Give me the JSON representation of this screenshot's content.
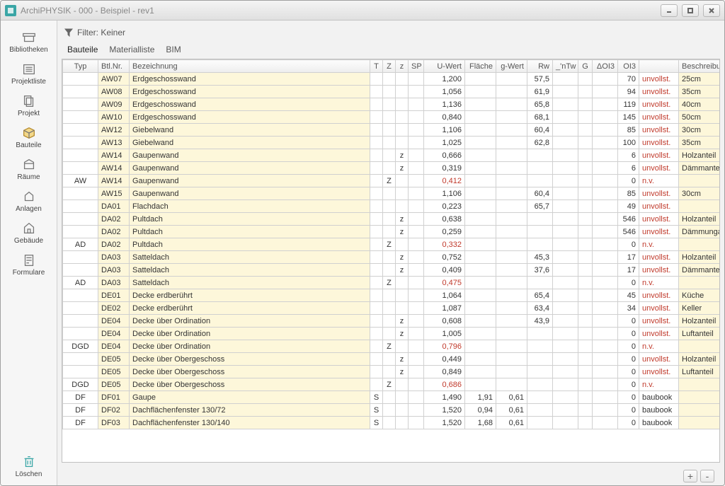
{
  "window": {
    "title": "ArchiPHYSIK - 000 - Beispiel - rev1"
  },
  "sidebar": {
    "items": [
      {
        "label": "Bibliotheken"
      },
      {
        "label": "Projektliste"
      },
      {
        "label": "Projekt"
      },
      {
        "label": "Bauteile"
      },
      {
        "label": "Räume"
      },
      {
        "label": "Anlagen"
      },
      {
        "label": "Gebäude"
      },
      {
        "label": "Formulare"
      }
    ],
    "delete_label": "Löschen"
  },
  "filter": {
    "label": "Filter: Keiner"
  },
  "tabs": [
    {
      "label": "Bauteile",
      "sel": true
    },
    {
      "label": "Materialliste",
      "sel": false
    },
    {
      "label": "BIM",
      "sel": false
    }
  ],
  "columns": [
    {
      "key": "typ",
      "label": "Typ"
    },
    {
      "key": "nr",
      "label": "Btl.Nr."
    },
    {
      "key": "bez",
      "label": "Bezeichnung"
    },
    {
      "key": "T",
      "label": "T"
    },
    {
      "key": "Z",
      "label": "Z"
    },
    {
      "key": "z",
      "label": "z"
    },
    {
      "key": "SP",
      "label": "SP"
    },
    {
      "key": "uw",
      "label": "U-Wert"
    },
    {
      "key": "fl",
      "label": "Fläche"
    },
    {
      "key": "gw",
      "label": "g-Wert"
    },
    {
      "key": "rw",
      "label": "Rw"
    },
    {
      "key": "ntw",
      "label": "_'nTw"
    },
    {
      "key": "G",
      "label": "G"
    },
    {
      "key": "doi",
      "label": "ΔOI3"
    },
    {
      "key": "oi3",
      "label": "OI3"
    },
    {
      "key": "besch",
      "label": "Beschreibung"
    }
  ],
  "rows": [
    {
      "typ": "",
      "nr": "AW07",
      "bez": "Erdgeschosswand",
      "T": "",
      "Z": "",
      "z": "",
      "SP": "",
      "uw": "1,200",
      "fl": "",
      "gw": "",
      "rw": "57,5",
      "ntw": "",
      "G": "",
      "doi": "",
      "oi3": "70",
      "oi3s": "unvollst.",
      "besch": "25cm",
      "yel": true
    },
    {
      "typ": "",
      "nr": "AW08",
      "bez": "Erdgeschosswand",
      "T": "",
      "Z": "",
      "z": "",
      "SP": "",
      "uw": "1,056",
      "fl": "",
      "gw": "",
      "rw": "61,9",
      "ntw": "",
      "G": "",
      "doi": "",
      "oi3": "94",
      "oi3s": "unvollst.",
      "besch": "35cm",
      "yel": true
    },
    {
      "typ": "",
      "nr": "AW09",
      "bez": "Erdgeschosswand",
      "T": "",
      "Z": "",
      "z": "",
      "SP": "",
      "uw": "1,136",
      "fl": "",
      "gw": "",
      "rw": "65,8",
      "ntw": "",
      "G": "",
      "doi": "",
      "oi3": "119",
      "oi3s": "unvollst.",
      "besch": "40cm",
      "yel": true
    },
    {
      "typ": "",
      "nr": "AW10",
      "bez": "Erdgeschosswand",
      "T": "",
      "Z": "",
      "z": "",
      "SP": "",
      "uw": "0,840",
      "fl": "",
      "gw": "",
      "rw": "68,1",
      "ntw": "",
      "G": "",
      "doi": "",
      "oi3": "145",
      "oi3s": "unvollst.",
      "besch": "50cm",
      "yel": true
    },
    {
      "typ": "",
      "nr": "AW12",
      "bez": "Giebelwand",
      "T": "",
      "Z": "",
      "z": "",
      "SP": "",
      "uw": "1,106",
      "fl": "",
      "gw": "",
      "rw": "60,4",
      "ntw": "",
      "G": "",
      "doi": "",
      "oi3": "85",
      "oi3s": "unvollst.",
      "besch": "30cm",
      "yel": true
    },
    {
      "typ": "",
      "nr": "AW13",
      "bez": "Giebelwand",
      "T": "",
      "Z": "",
      "z": "",
      "SP": "",
      "uw": "1,025",
      "fl": "",
      "gw": "",
      "rw": "62,8",
      "ntw": "",
      "G": "",
      "doi": "",
      "oi3": "100",
      "oi3s": "unvollst.",
      "besch": "35cm",
      "yel": true
    },
    {
      "typ": "",
      "nr": "AW14",
      "bez": "Gaupenwand",
      "T": "",
      "Z": "",
      "z": "z",
      "SP": "",
      "uw": "0,666",
      "fl": "",
      "gw": "",
      "rw": "",
      "ntw": "",
      "G": "",
      "doi": "",
      "oi3": "6",
      "oi3s": "unvollst.",
      "besch": "Holzanteil",
      "yel": true
    },
    {
      "typ": "",
      "nr": "AW14",
      "bez": "Gaupenwand",
      "T": "",
      "Z": "",
      "z": "z",
      "SP": "",
      "uw": "0,319",
      "fl": "",
      "gw": "",
      "rw": "",
      "ntw": "",
      "G": "",
      "doi": "",
      "oi3": "6",
      "oi3s": "unvollst.",
      "besch": "Dämmanteil",
      "yel": true
    },
    {
      "typ": "AW",
      "nr": "AW14",
      "bez": "Gaupenwand",
      "T": "",
      "Z": "Z",
      "z": "",
      "SP": "",
      "uw": "0,412",
      "uwRed": true,
      "fl": "",
      "gw": "",
      "rw": "",
      "ntw": "",
      "G": "",
      "doi": "",
      "oi3": "0",
      "oi3s": "n.v.",
      "besch": "",
      "yel": true
    },
    {
      "typ": "",
      "nr": "AW15",
      "bez": "Gaupenwand",
      "T": "",
      "Z": "",
      "z": "",
      "SP": "",
      "uw": "1,106",
      "fl": "",
      "gw": "",
      "rw": "60,4",
      "ntw": "",
      "G": "",
      "doi": "",
      "oi3": "85",
      "oi3s": "unvollst.",
      "besch": "30cm",
      "yel": true
    },
    {
      "typ": "",
      "nr": "DA01",
      "bez": "Flachdach",
      "T": "",
      "Z": "",
      "z": "",
      "SP": "",
      "uw": "0,223",
      "fl": "",
      "gw": "",
      "rw": "65,7",
      "ntw": "",
      "G": "",
      "doi": "",
      "oi3": "49",
      "oi3s": "unvollst.",
      "besch": "",
      "yel": true
    },
    {
      "typ": "",
      "nr": "DA02",
      "bez": "Pultdach",
      "T": "",
      "Z": "",
      "z": "z",
      "SP": "",
      "uw": "0,638",
      "fl": "",
      "gw": "",
      "rw": "",
      "ntw": "",
      "G": "",
      "doi": "",
      "oi3": "546",
      "oi3s": "unvollst.",
      "besch": "Holzanteil",
      "yel": true
    },
    {
      "typ": "",
      "nr": "DA02",
      "bez": "Pultdach",
      "T": "",
      "Z": "",
      "z": "z",
      "SP": "",
      "uw": "0,259",
      "fl": "",
      "gw": "",
      "rw": "",
      "ntw": "",
      "G": "",
      "doi": "",
      "oi3": "546",
      "oi3s": "unvollst.",
      "besch": "Dämmunga",
      "yel": true
    },
    {
      "typ": "AD",
      "nr": "DA02",
      "bez": "Pultdach",
      "T": "",
      "Z": "Z",
      "z": "",
      "SP": "",
      "uw": "0,332",
      "uwRed": true,
      "fl": "",
      "gw": "",
      "rw": "",
      "ntw": "",
      "G": "",
      "doi": "",
      "oi3": "0",
      "oi3s": "n.v.",
      "besch": "",
      "yel": true
    },
    {
      "typ": "",
      "nr": "DA03",
      "bez": "Satteldach",
      "T": "",
      "Z": "",
      "z": "z",
      "SP": "",
      "uw": "0,752",
      "fl": "",
      "gw": "",
      "rw": "45,3",
      "ntw": "",
      "G": "",
      "doi": "",
      "oi3": "17",
      "oi3s": "unvollst.",
      "besch": "Holzanteil",
      "yel": true
    },
    {
      "typ": "",
      "nr": "DA03",
      "bez": "Satteldach",
      "T": "",
      "Z": "",
      "z": "z",
      "SP": "",
      "uw": "0,409",
      "fl": "",
      "gw": "",
      "rw": "37,6",
      "ntw": "",
      "G": "",
      "doi": "",
      "oi3": "17",
      "oi3s": "unvollst.",
      "besch": "Dämmanteil",
      "yel": true
    },
    {
      "typ": "AD",
      "nr": "DA03",
      "bez": "Satteldach",
      "T": "",
      "Z": "Z",
      "z": "",
      "SP": "",
      "uw": "0,475",
      "uwRed": true,
      "fl": "",
      "gw": "",
      "rw": "",
      "ntw": "",
      "G": "",
      "doi": "",
      "oi3": "0",
      "oi3s": "n.v.",
      "besch": "",
      "yel": true
    },
    {
      "typ": "",
      "nr": "DE01",
      "bez": "Decke erdberührt",
      "T": "",
      "Z": "",
      "z": "",
      "SP": "",
      "uw": "1,064",
      "fl": "",
      "gw": "",
      "rw": "65,4",
      "ntw": "",
      "G": "",
      "doi": "",
      "oi3": "45",
      "oi3s": "unvollst.",
      "besch": "Küche",
      "yel": true
    },
    {
      "typ": "",
      "nr": "DE02",
      "bez": "Decke erdberührt",
      "T": "",
      "Z": "",
      "z": "",
      "SP": "",
      "uw": "1,087",
      "fl": "",
      "gw": "",
      "rw": "63,4",
      "ntw": "",
      "G": "",
      "doi": "",
      "oi3": "34",
      "oi3s": "unvollst.",
      "besch": "Keller",
      "yel": true
    },
    {
      "typ": "",
      "nr": "DE04",
      "bez": "Decke über Ordination",
      "T": "",
      "Z": "",
      "z": "z",
      "SP": "",
      "uw": "0,608",
      "fl": "",
      "gw": "",
      "rw": "43,9",
      "ntw": "",
      "G": "",
      "doi": "",
      "oi3": "0",
      "oi3s": "unvollst.",
      "besch": "Holzanteil",
      "yel": true
    },
    {
      "typ": "",
      "nr": "DE04",
      "bez": "Decke über Ordination",
      "T": "",
      "Z": "",
      "z": "z",
      "SP": "",
      "uw": "1,005",
      "fl": "",
      "gw": "",
      "rw": "",
      "ntw": "",
      "G": "",
      "doi": "",
      "oi3": "0",
      "oi3s": "unvollst.",
      "besch": "Luftanteil",
      "yel": true
    },
    {
      "typ": "DGD",
      "nr": "DE04",
      "bez": "Decke über Ordination",
      "T": "",
      "Z": "Z",
      "z": "",
      "SP": "",
      "uw": "0,796",
      "uwRed": true,
      "fl": "",
      "gw": "",
      "rw": "",
      "ntw": "",
      "G": "",
      "doi": "",
      "oi3": "0",
      "oi3s": "n.v.",
      "besch": "",
      "yel": true
    },
    {
      "typ": "",
      "nr": "DE05",
      "bez": "Decke über Obergeschoss",
      "T": "",
      "Z": "",
      "z": "z",
      "SP": "",
      "uw": "0,449",
      "fl": "",
      "gw": "",
      "rw": "",
      "ntw": "",
      "G": "",
      "doi": "",
      "oi3": "0",
      "oi3s": "unvollst.",
      "besch": "Holzanteil",
      "yel": true
    },
    {
      "typ": "",
      "nr": "DE05",
      "bez": "Decke über Obergeschoss",
      "T": "",
      "Z": "",
      "z": "z",
      "SP": "",
      "uw": "0,849",
      "fl": "",
      "gw": "",
      "rw": "",
      "ntw": "",
      "G": "",
      "doi": "",
      "oi3": "0",
      "oi3s": "unvollst.",
      "besch": "Luftanteil",
      "yel": true
    },
    {
      "typ": "DGD",
      "nr": "DE05",
      "bez": "Decke über Obergeschoss",
      "T": "",
      "Z": "Z",
      "z": "",
      "SP": "",
      "uw": "0,686",
      "uwRed": true,
      "fl": "",
      "gw": "",
      "rw": "",
      "ntw": "",
      "G": "",
      "doi": "",
      "oi3": "0",
      "oi3s": "n.v.",
      "besch": "",
      "yel": true
    },
    {
      "typ": "DF",
      "nr": "DF01",
      "bez": "Gaupe",
      "T": "S",
      "Z": "",
      "z": "",
      "SP": "",
      "uw": "1,490",
      "fl": "1,91",
      "gw": "0,61",
      "rw": "",
      "ntw": "",
      "G": "",
      "doi": "",
      "oi3": "0",
      "oi3s": "baubook",
      "besch": "",
      "yel": true
    },
    {
      "typ": "DF",
      "nr": "DF02",
      "bez": "Dachflächenfenster 130/72",
      "T": "S",
      "Z": "",
      "z": "",
      "SP": "",
      "uw": "1,520",
      "fl": "0,94",
      "gw": "0,61",
      "rw": "",
      "ntw": "",
      "G": "",
      "doi": "",
      "oi3": "0",
      "oi3s": "baubook",
      "besch": "",
      "yel": true
    },
    {
      "typ": "DF",
      "nr": "DF03",
      "bez": "Dachflächenfenster 130/140",
      "T": "S",
      "Z": "",
      "z": "",
      "SP": "",
      "uw": "1,520",
      "fl": "1,68",
      "gw": "0,61",
      "rw": "",
      "ntw": "",
      "G": "",
      "doi": "",
      "oi3": "0",
      "oi3s": "baubook",
      "besch": "",
      "yel": true
    }
  ],
  "footer": {
    "plus": "+",
    "minus": "-"
  }
}
